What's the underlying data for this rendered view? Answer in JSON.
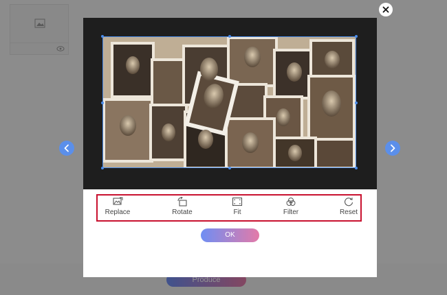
{
  "background": {
    "produce_label": "Produce"
  },
  "dialog": {
    "tools": [
      {
        "label": "Replace",
        "icon": "replace-icon"
      },
      {
        "label": "Rotate",
        "icon": "rotate-icon"
      },
      {
        "label": "Fit",
        "icon": "fit-icon"
      },
      {
        "label": "Filter",
        "icon": "filter-icon"
      },
      {
        "label": "Reset",
        "icon": "reset-icon"
      }
    ],
    "ok_label": "OK",
    "image_alt": "Sepia photo collage",
    "close_icon": "close-icon",
    "prev_icon": "chevron-left-icon",
    "next_icon": "chevron-right-icon"
  },
  "colors": {
    "accent": "#4a8be8",
    "highlight": "#c8102e",
    "gradient_start": "#6f8ef3",
    "gradient_end": "#e37aa8"
  }
}
